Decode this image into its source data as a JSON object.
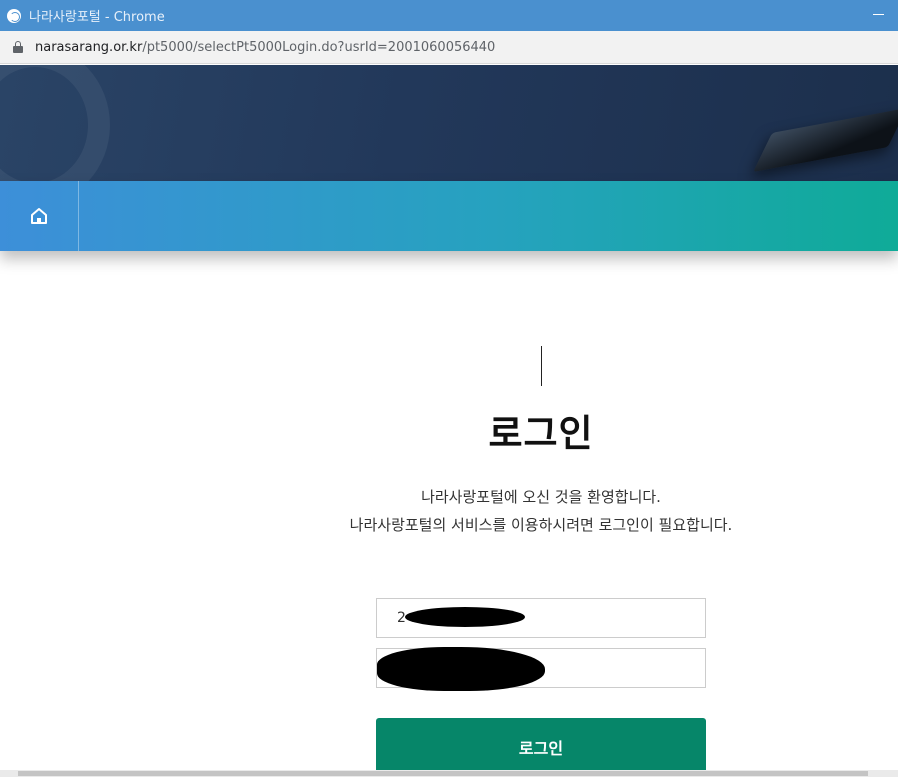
{
  "window": {
    "title": "나라사랑포털 - Chrome"
  },
  "address": {
    "host": "narasarang.or.kr",
    "path": "/pt5000/selectPt5000Login.do?usrId=2001060056440"
  },
  "nav": {
    "home_icon": "home-icon"
  },
  "login": {
    "title": "로그인",
    "welcome_line1": "나라사랑포털에 오신 것을 환영합니다.",
    "welcome_line2": "나라사랑포털의 서비스를 이용하시려면 로그인이 필요합니다.",
    "id_value_visible": "2",
    "button_label": "로그인"
  },
  "colors": {
    "titlebar": "#4a90cf",
    "nav_gradient_start": "#3d8fd9",
    "nav_gradient_end": "#0fab98",
    "login_button": "#068669",
    "title_highlight": "#ffe100"
  }
}
